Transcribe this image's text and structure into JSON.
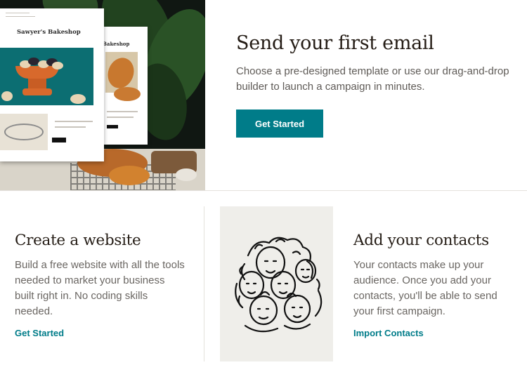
{
  "hero": {
    "preview_card_title": "Sawyer's Bakeshop",
    "preview_card_back_title": "Bakeshop",
    "title": "Send your first email",
    "description": "Choose a pre-designed template or use our drag-and-drop builder to launch a campaign in minutes.",
    "button_label": "Get Started"
  },
  "website": {
    "title": "Create a website",
    "description": "Build a free website with all the tools needed to market your business built right in. No coding skills needed.",
    "link_label": "Get Started"
  },
  "contacts": {
    "title": "Add your contacts",
    "description": "Your contacts make up your audience. Once you add your contacts, you'll be able to send your first campaign.",
    "link_label": "Import Contacts"
  },
  "colors": {
    "accent": "#007c89",
    "heading": "#241c15",
    "body_text": "#6a6662",
    "illustration_bg": "#efeeea"
  },
  "icons": {
    "hero_image": "email-template-preview-image",
    "contacts_illustration": "crowd-of-faces-illustration"
  }
}
